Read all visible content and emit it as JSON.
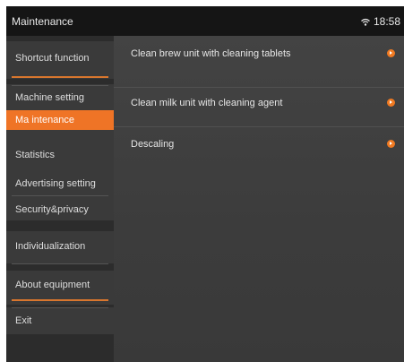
{
  "status_bar": {
    "title": "Maintenance",
    "time": "18:58"
  },
  "sidebar": {
    "items": [
      {
        "label": "Shortcut function"
      },
      {
        "label": "Machine setting"
      },
      {
        "label": "Ma intenance",
        "selected": true
      },
      {
        "label": "Statistics"
      },
      {
        "label": "Advertising setting"
      },
      {
        "label": "Security&privacy"
      },
      {
        "label": "Individualization"
      },
      {
        "label": "About equipment"
      },
      {
        "label": "Exit"
      }
    ]
  },
  "content": {
    "rows": [
      {
        "label": "Clean brew unit with cleaning tablets"
      },
      {
        "label": "Clean milk unit with cleaning agent"
      },
      {
        "label": "Descaling"
      }
    ]
  },
  "colors": {
    "accent": "#ef7426",
    "background": "#3a3a3a",
    "status_bar": "#151515"
  }
}
